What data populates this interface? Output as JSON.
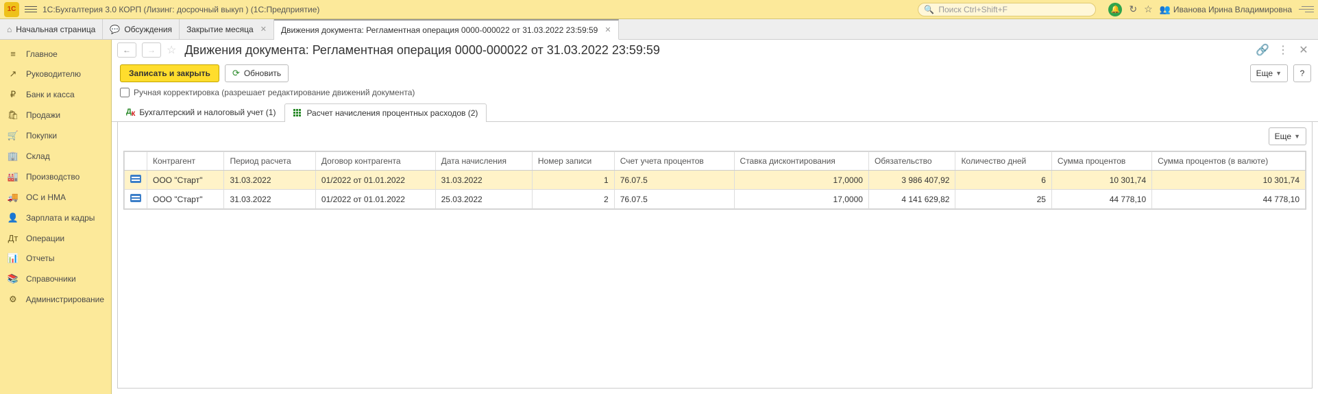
{
  "titlebar": {
    "app_title": "1С:Бухгалтерия 3.0 КОРП (Лизинг: досрочный выкуп )  (1С:Предприятие)",
    "search_placeholder": "Поиск Ctrl+Shift+F",
    "user_name": "Иванова Ирина Владимировна"
  },
  "maintabs": {
    "start": "Начальная страница",
    "items": [
      {
        "label": "Обсуждения",
        "closable": false,
        "hasicon": true
      },
      {
        "label": "Закрытие месяца",
        "closable": true
      },
      {
        "label": "Движения документа: Регламентная операция 0000-000022 от 31.03.2022 23:59:59",
        "closable": true,
        "active": true
      }
    ]
  },
  "sidebar": {
    "items": [
      {
        "icon": "≡",
        "label": "Главное"
      },
      {
        "icon": "↗",
        "label": "Руководителю"
      },
      {
        "icon": "₽",
        "label": "Банк и касса"
      },
      {
        "icon": "🛍",
        "label": "Продажи"
      },
      {
        "icon": "🛒",
        "label": "Покупки"
      },
      {
        "icon": "🏢",
        "label": "Склад"
      },
      {
        "icon": "🏭",
        "label": "Производство"
      },
      {
        "icon": "🚚",
        "label": "ОС и НМА"
      },
      {
        "icon": "👤",
        "label": "Зарплата и кадры"
      },
      {
        "icon": "Дт",
        "label": "Операции"
      },
      {
        "icon": "📊",
        "label": "Отчеты"
      },
      {
        "icon": "📚",
        "label": "Справочники"
      },
      {
        "icon": "⚙",
        "label": "Администрирование"
      }
    ]
  },
  "doc": {
    "title": "Движения документа: Регламентная операция 0000-000022 от 31.03.2022 23:59:59",
    "save_close": "Записать и закрыть",
    "refresh": "Обновить",
    "more": "Еще",
    "help": "?",
    "manual_edit_label": "Ручная корректировка (разрешает редактирование движений документа)"
  },
  "innertabs": [
    {
      "label": "Бухгалтерский и налоговый учет (1)"
    },
    {
      "label": "Расчет начисления процентных расходов (2)",
      "active": true
    }
  ],
  "table": {
    "more": "Еще",
    "headers": [
      "Контрагент",
      "Период расчета",
      "Договор контрагента",
      "Дата начисления",
      "Номер записи",
      "Счет учета процентов",
      "Ставка дисконтирования",
      "Обязательство",
      "Количество дней",
      "Сумма процентов",
      "Сумма процентов (в валюте)"
    ],
    "rows": [
      {
        "c": "ООО \"Старт\"",
        "p": "31.03.2022",
        "d": "01/2022 от 01.01.2022",
        "dn": "31.03.2022",
        "n": "1",
        "ac": "76.07.5",
        "rate": "17,0000",
        "ob": "3 986 407,92",
        "days": "6",
        "sum": "10 301,74",
        "sumv": "10 301,74",
        "selected": true
      },
      {
        "c": "ООО \"Старт\"",
        "p": "31.03.2022",
        "d": "01/2022 от 01.01.2022",
        "dn": "25.03.2022",
        "n": "2",
        "ac": "76.07.5",
        "rate": "17,0000",
        "ob": "4 141 629,82",
        "days": "25",
        "sum": "44 778,10",
        "sumv": "44 778,10"
      }
    ]
  }
}
